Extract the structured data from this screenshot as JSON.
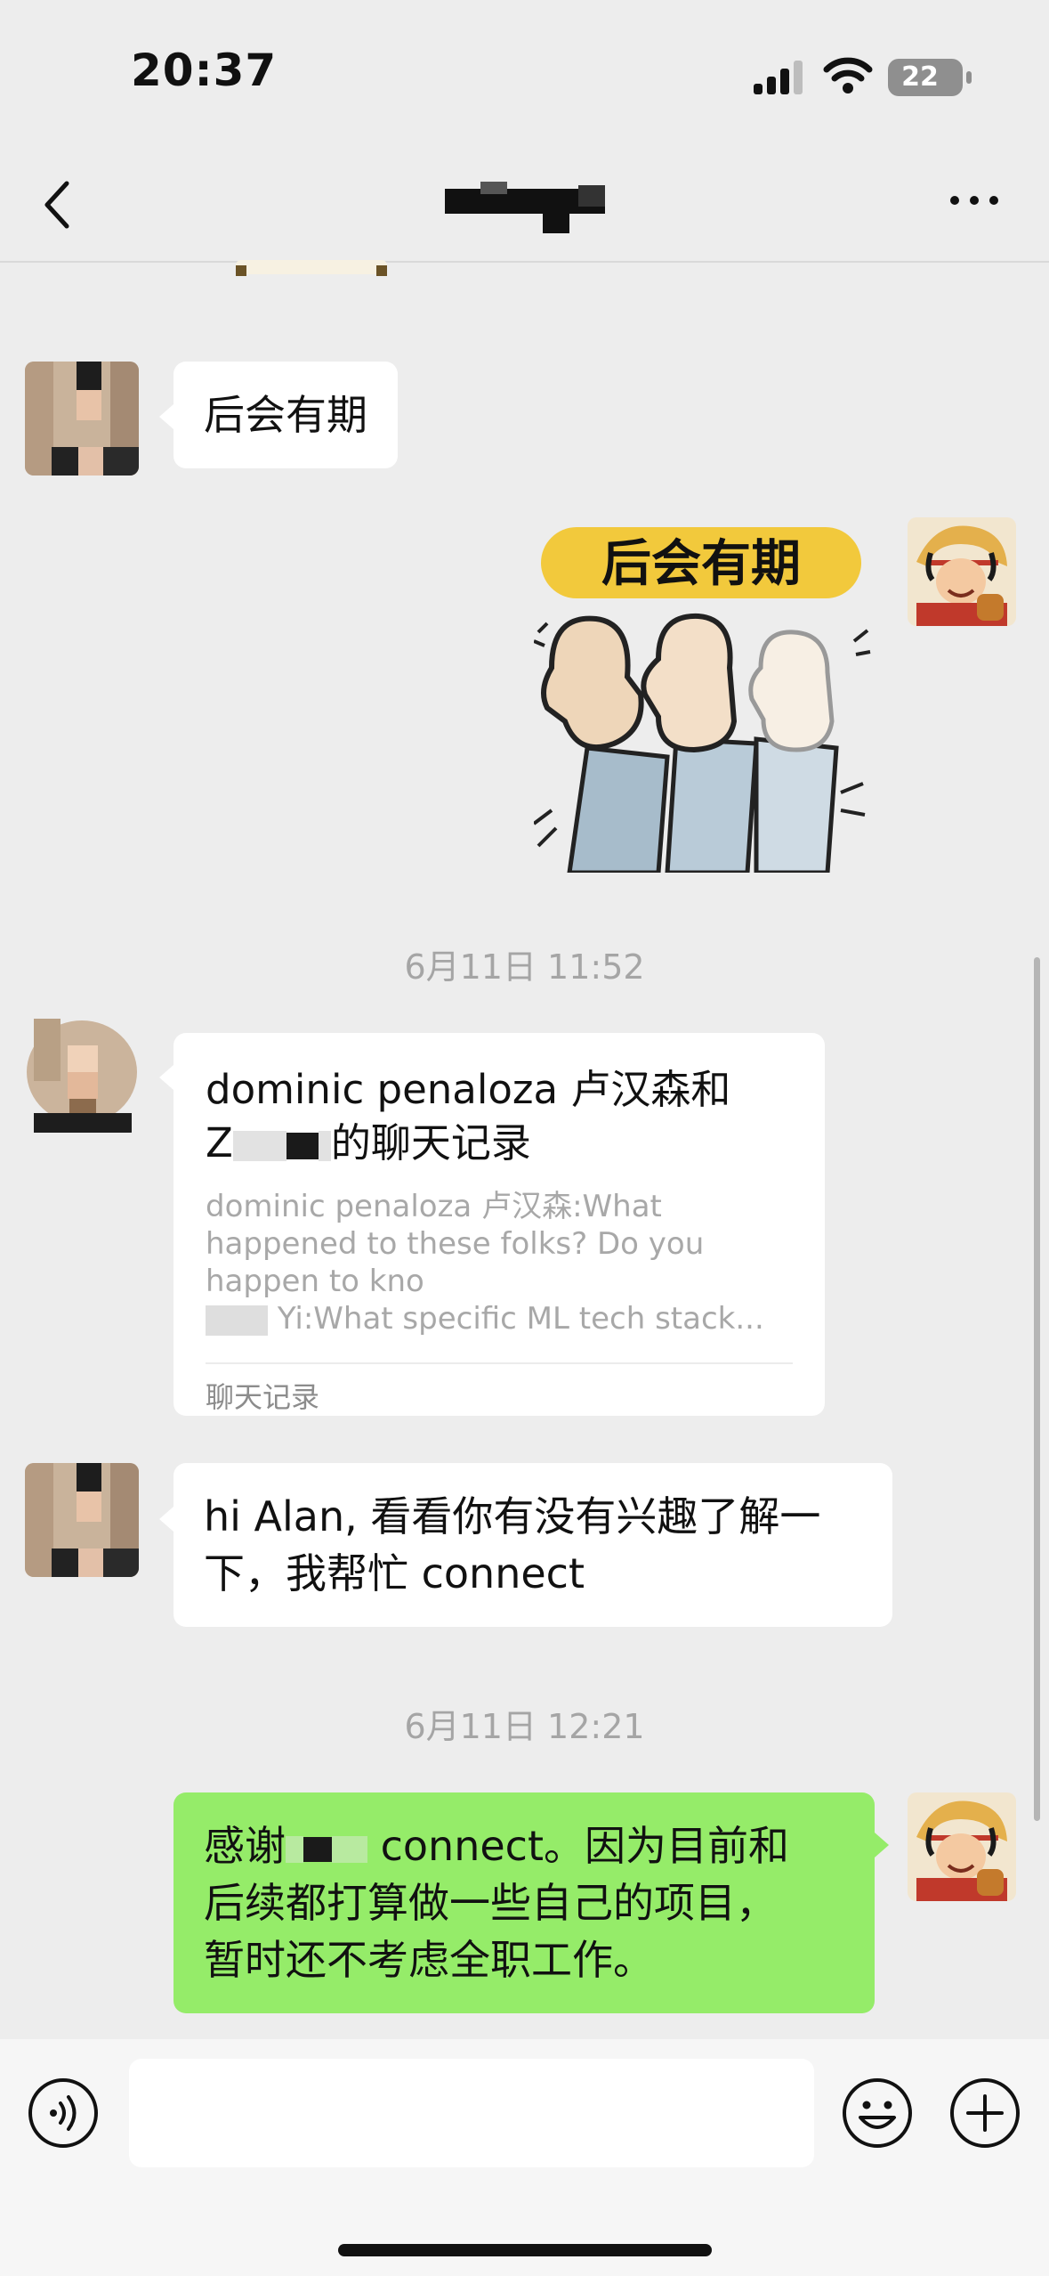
{
  "status_bar": {
    "time": "20:37",
    "battery": "22"
  },
  "nav": {
    "title": ""
  },
  "messages": {
    "m1_text": "后会有期",
    "sticker_text": "后会有期",
    "ts1": "6月11日 11:52",
    "card": {
      "title_line1": "dominic penaloza 卢汉森和",
      "title_line2_prefix": "Z",
      "title_line2_suffix": "的聊天记录",
      "preview_line1": "dominic penaloza 卢汉森:What",
      "preview_line2": "happened to these folks? Do you",
      "preview_line3": "happen to kno",
      "preview_line4": "Yi:What specific ML tech stack...",
      "footer": "聊天记录"
    },
    "m3_line1": "hi Alan, 看看你有没有兴趣了解一",
    "m3_line2": "下，我帮忙 connect",
    "ts2": "6月11日 12:21",
    "m4_prefix": "感谢",
    "m4_line1_rest": "connect。因为目前和",
    "m4_line2": "后续都打算做一些自己的项目，",
    "m4_line3": "暂时还不考虑全职工作。"
  },
  "input": {
    "placeholder": ""
  },
  "colors": {
    "background": "#ededed",
    "bubble_green": "#95ec69",
    "bubble_white": "#ffffff"
  },
  "icons": [
    "back-icon",
    "more-icon",
    "voice-icon",
    "emoji-icon",
    "plus-icon",
    "signal-icon",
    "wifi-icon",
    "battery-icon"
  ]
}
